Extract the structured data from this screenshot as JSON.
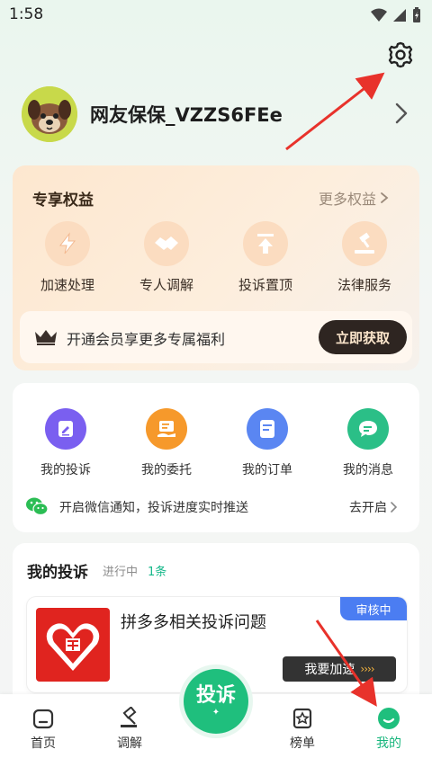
{
  "status_bar": {
    "time": "1:58"
  },
  "profile": {
    "username": "网友保保_VZZS6FEe"
  },
  "benefits": {
    "title": "专享权益",
    "more_label": "更多权益",
    "items": [
      {
        "label": "加速处理",
        "icon": "lightning-icon"
      },
      {
        "label": "专人调解",
        "icon": "handshake-icon"
      },
      {
        "label": "投诉置顶",
        "icon": "pin-top-icon"
      },
      {
        "label": "法律服务",
        "icon": "gavel-icon"
      }
    ],
    "vip_text": "开通会员享更多专属福利",
    "vip_button": "立即获取"
  },
  "functions": {
    "items": [
      {
        "label": "我的投诉",
        "icon": "complaint-edit-icon",
        "color": "#7a5ff0"
      },
      {
        "label": "我的委托",
        "icon": "delegate-icon",
        "color": "#f6992b"
      },
      {
        "label": "我的订单",
        "icon": "order-icon",
        "color": "#5a86f2"
      },
      {
        "label": "我的消息",
        "icon": "message-icon",
        "color": "#2bbf87"
      }
    ],
    "wechat_text": "开启微信通知，投诉进度实时推送",
    "wechat_action": "去开启"
  },
  "complaints": {
    "title": "我的投诉",
    "status": "进行中",
    "count": "1条",
    "item": {
      "title": "拼多多相关投诉问题",
      "badge": "审核中",
      "speed_button": "我要加速",
      "speed_arrows": "››››"
    }
  },
  "bottom_nav": {
    "items": [
      {
        "label": "首页",
        "icon": "home-icon"
      },
      {
        "label": "调解",
        "icon": "gavel-icon"
      },
      {
        "label": "榜单",
        "icon": "ranking-icon"
      },
      {
        "label": "我的",
        "icon": "profile-icon"
      }
    ],
    "center_label": "投诉",
    "active": "我的"
  },
  "colors": {
    "accent": "#1fbf7d",
    "arrow": "#e8322b"
  }
}
